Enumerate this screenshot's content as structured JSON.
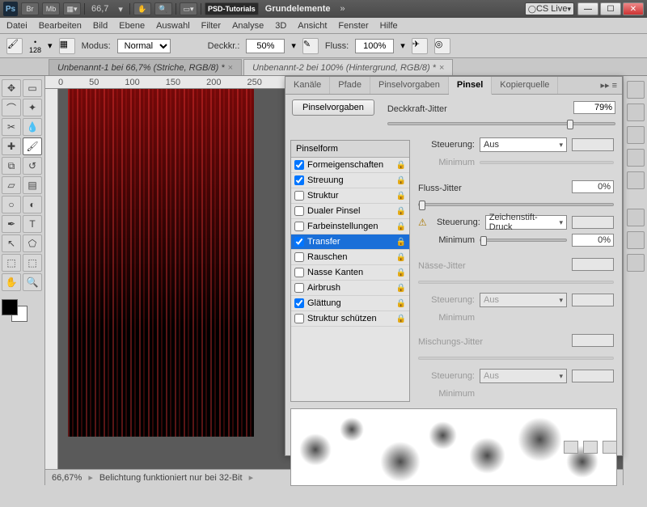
{
  "titlebar": {
    "zoom": "66,7",
    "workspace_btn": "PSD-Tutorials",
    "workspace_txt": "Grundelemente",
    "cslive": "CS Live"
  },
  "menu": [
    "Datei",
    "Bearbeiten",
    "Bild",
    "Ebene",
    "Auswahl",
    "Filter",
    "Analyse",
    "3D",
    "Ansicht",
    "Fenster",
    "Hilfe"
  ],
  "options": {
    "size": "128",
    "mode_label": "Modus:",
    "mode": "Normal",
    "opacity_label": "Deckkr.:",
    "opacity": "50%",
    "flow_label": "Fluss:",
    "flow": "100%"
  },
  "doctabs": [
    {
      "label": "Unbenannt-1 bei 66,7% (Striche, RGB/8) *",
      "active": true
    },
    {
      "label": "Unbenannt-2 bei 100% (Hintergrund, RGB/8) *",
      "active": false
    }
  ],
  "ruler_marks": [
    "0",
    "50",
    "100",
    "150",
    "200",
    "250"
  ],
  "status": {
    "zoom": "66,67%",
    "msg": "Belichtung funktioniert nur bei 32-Bit"
  },
  "panel": {
    "tabs": [
      "Kanäle",
      "Pfade",
      "Pinselvorgaben",
      "Pinsel",
      "Kopierquelle"
    ],
    "active_tab": 3,
    "preset_btn": "Pinselvorgaben",
    "left_head": "Pinselform",
    "items": [
      {
        "label": "Formeigenschaften",
        "checked": true
      },
      {
        "label": "Streuung",
        "checked": true
      },
      {
        "label": "Struktur",
        "checked": false
      },
      {
        "label": "Dualer Pinsel",
        "checked": false
      },
      {
        "label": "Farbeinstellungen",
        "checked": false
      },
      {
        "label": "Transfer",
        "checked": true,
        "selected": true
      },
      {
        "label": "Rauschen",
        "checked": false
      },
      {
        "label": "Nasse Kanten",
        "checked": false
      },
      {
        "label": "Airbrush",
        "checked": false
      },
      {
        "label": "Glättung",
        "checked": true
      },
      {
        "label": "Struktur schützen",
        "checked": false
      }
    ],
    "r": {
      "opj_label": "Deckkraft-Jitter",
      "opj_val": "79%",
      "ctrl_label": "Steuerung:",
      "ctrl1": "Aus",
      "min_label": "Minimum",
      "flj_label": "Fluss-Jitter",
      "flj_val": "0%",
      "ctrl2": "Zeichenstift-Druck",
      "min2_label": "Minimum",
      "min2_val": "0%",
      "wet_label": "Nässe-Jitter",
      "ctrl3": "Aus",
      "mix_label": "Mischungs-Jitter",
      "ctrl4": "Aus"
    }
  }
}
